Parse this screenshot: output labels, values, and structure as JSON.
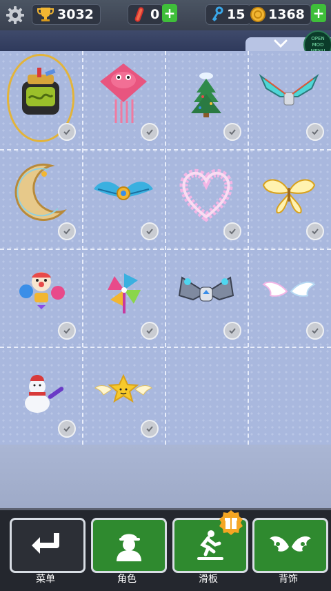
{
  "stats": {
    "trophies": "3032",
    "boards": "0",
    "keys": "15",
    "coins": "1368",
    "plus": "+"
  },
  "mod_menu": {
    "line1": "OPEN",
    "line2": "MOD MENU"
  },
  "grid": {
    "items": [
      {
        "name": "backpack-item",
        "selected": true
      },
      {
        "name": "pink-bird-kite-item"
      },
      {
        "name": "christmas-tree-item"
      },
      {
        "name": "mecha-wings-item"
      },
      {
        "name": "crescent-moon-item"
      },
      {
        "name": "blue-feather-wings-item"
      },
      {
        "name": "flower-heart-item"
      },
      {
        "name": "golden-butterfly-wings-item"
      },
      {
        "name": "clown-balloons-item"
      },
      {
        "name": "pinwheel-item"
      },
      {
        "name": "drone-wings-item"
      },
      {
        "name": "white-angel-wings-item"
      },
      {
        "name": "snowman-item"
      },
      {
        "name": "winged-star-item"
      }
    ]
  },
  "nav": {
    "menu": "菜单",
    "character": "角色",
    "board": "滑板",
    "backpack": "背饰"
  },
  "colors": {
    "green_button": "#2f8a2f",
    "dark_button": "#2c2f36",
    "accent_gold": "#f5a623"
  }
}
